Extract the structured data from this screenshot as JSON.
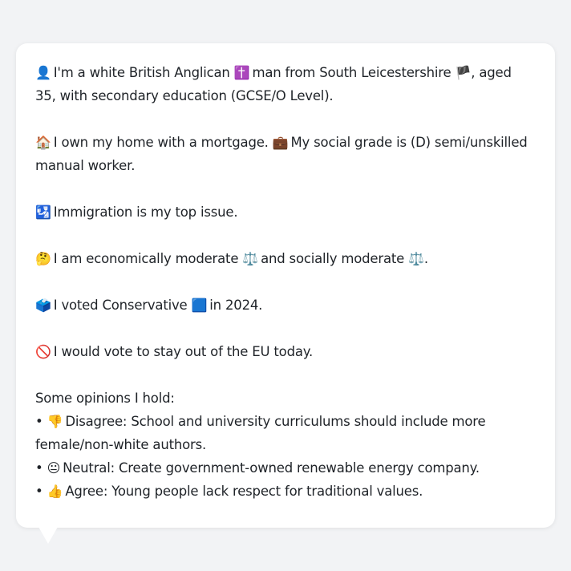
{
  "profile": {
    "line1": {
      "icon1": "👤",
      "text1": "I'm a white British Anglican",
      "icon2": "✝️",
      "text2": "man from South Leicestershire",
      "icon3": "🏴",
      "text3": ", aged 35, with secondary education (GCSE/O Level)."
    },
    "line2": {
      "icon1": "🏠",
      "text1": "I own my home with a mortgage.",
      "icon2": "💼",
      "text2": "My social grade is (D) semi/unskilled manual worker."
    },
    "line3": {
      "icon1": "🛂",
      "text1": "Immigration is my top issue."
    },
    "line4": {
      "icon1": "🤔",
      "text1": "I am economically moderate",
      "icon2": "⚖️",
      "text2": "and socially moderate",
      "icon3": "⚖️",
      "text3": "."
    },
    "line5": {
      "icon1": "🗳️",
      "text1": "I voted Conservative",
      "icon2": "🟦",
      "text2": "in 2024."
    },
    "line6": {
      "icon1": "🚫",
      "text1": "I would vote to stay out of the EU today."
    }
  },
  "opinions": {
    "heading": "Some opinions I hold:",
    "items": [
      {
        "bullet": "•",
        "icon": "👎",
        "text": "Disagree: School and university curriculums should include more female/non-white authors."
      },
      {
        "bullet": "•",
        "icon": "😐",
        "text": "Neutral: Create government-owned renewable energy company."
      },
      {
        "bullet": "•",
        "icon": "👍",
        "text": "Agree: Young people lack respect for traditional values."
      }
    ]
  }
}
